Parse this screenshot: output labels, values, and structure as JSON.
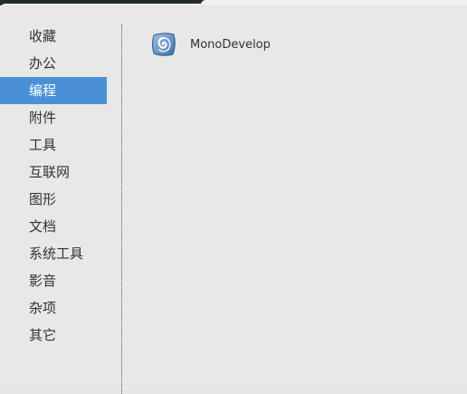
{
  "categories": [
    {
      "label": "收藏"
    },
    {
      "label": "办公"
    },
    {
      "label": "编程"
    },
    {
      "label": "附件"
    },
    {
      "label": "工具"
    },
    {
      "label": "互联网"
    },
    {
      "label": "图形"
    },
    {
      "label": "文档"
    },
    {
      "label": "系统工具"
    },
    {
      "label": "影音"
    },
    {
      "label": "杂项"
    },
    {
      "label": "其它"
    }
  ],
  "selected_category": "编程",
  "apps": [
    {
      "label": "MonoDevelop",
      "icon": "monodevelop-icon"
    }
  ],
  "colors": {
    "selection": "#4a90d9",
    "panel_background": "#e8e8e8",
    "text": "#2e3436"
  }
}
